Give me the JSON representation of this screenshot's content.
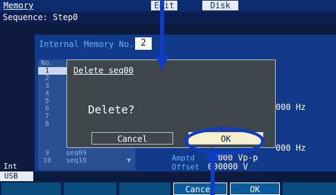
{
  "window": {
    "title": "Memory",
    "tabs": [
      {
        "label": "Edit"
      },
      {
        "label": "Disk"
      }
    ]
  },
  "sequence_bar": {
    "text": "Sequence: Step0"
  },
  "panel": {
    "internal_label": "Internal Memory No.",
    "memory_number": "2"
  },
  "memory_list": {
    "header_no": "No.",
    "rows": [
      {
        "no": "1",
        "name": ""
      },
      {
        "no": "2",
        "name": ""
      },
      {
        "no": "3",
        "name": ""
      },
      {
        "no": "4",
        "name": ""
      },
      {
        "no": "5",
        "name": ""
      },
      {
        "no": "6",
        "name": ""
      },
      {
        "no": "7",
        "name": ""
      },
      {
        "no": "8",
        "name": ""
      },
      {
        "no": "9",
        "name": "seq09"
      },
      {
        "no": "10",
        "name": "seq10"
      }
    ]
  },
  "background_values": {
    "freq1": "000 Hz",
    "freq2": "000 Hz",
    "amptd_label": "Amptd",
    "amptd_value": "00000 Vp-p",
    "offset_label": "Offset",
    "offset_value": "000000 V"
  },
  "sidebar": {
    "int_label": "Int",
    "usb_label": "USB"
  },
  "softkeys": {
    "cancel": "Cancel",
    "ok": "OK"
  },
  "dialog": {
    "title": "Delete seq00",
    "message": "Delete?",
    "cancel_label": "Cancel",
    "ok_label": "OK"
  },
  "colors": {
    "annotation": "#0e3cc4",
    "dialog_bg": "#3f464b",
    "ok_button": "#f5f0cf"
  }
}
